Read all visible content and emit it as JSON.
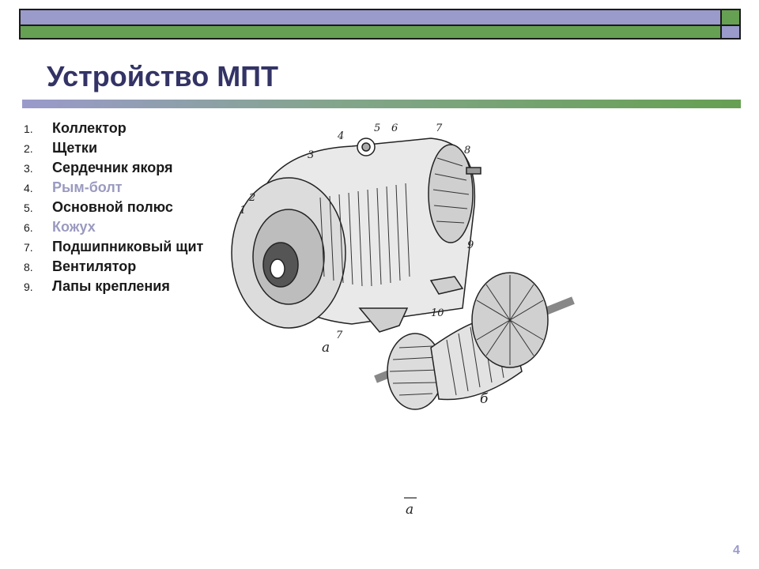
{
  "title": "Устройство МПТ",
  "items": [
    {
      "num": "1.",
      "text": "Коллектор"
    },
    {
      "num": "2.",
      "text": "Щетки"
    },
    {
      "num": "3.",
      "text": "Сердечник якоря"
    },
    {
      "num": "4.",
      "text": "Рым-болт"
    },
    {
      "num": "5.",
      "text": "Основной полюс"
    },
    {
      "num": "6.",
      "text": "Кожух"
    },
    {
      "num": "7.",
      "text": "Подшипниковый щит"
    },
    {
      "num": "8.",
      "text": "Вентилятор"
    },
    {
      "num": "9.",
      "text": "Лапы крепления"
    }
  ],
  "figure": {
    "callouts": [
      "1",
      "2",
      "3",
      "4",
      "5",
      "6",
      "7",
      "8",
      "9",
      "10",
      "7"
    ],
    "caption_a": "а",
    "caption_b": "б",
    "caption_bottom": "а"
  },
  "page_number": "4",
  "colors": {
    "title": "#333366",
    "band_lavender": "#9a9acb",
    "band_green": "#66a052",
    "muted_item": "#9a9ac0"
  }
}
